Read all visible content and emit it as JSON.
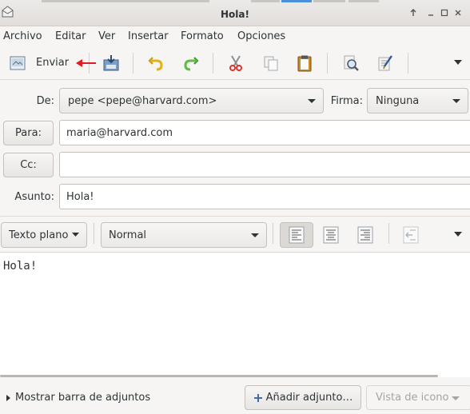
{
  "window": {
    "title": "Hola!",
    "buttons": [
      "up-icon",
      "minimize-icon",
      "restore-icon",
      "close-icon"
    ]
  },
  "menubar": {
    "items": [
      "Archivo",
      "Editar",
      "Ver",
      "Insertar",
      "Formato",
      "Opciones"
    ]
  },
  "toolbar": {
    "send_label": "Enviar",
    "icons": [
      "send-icon",
      "save-icon",
      "undo-icon",
      "redo-icon",
      "cut-icon",
      "copy-icon",
      "paste-icon",
      "find-icon",
      "spellcheck-icon",
      "overflow-icon"
    ]
  },
  "header": {
    "from_label": "De:",
    "from_value": "pepe <pepe@harvard.com>",
    "signature_label": "Firma:",
    "signature_value": "Ninguna",
    "to_button": "Para:",
    "to_value": "maria@harvard.com",
    "cc_button": "Cc:",
    "cc_value": "",
    "subject_label": "Asunto:",
    "subject_value": "Hola!"
  },
  "format": {
    "mode_label": "Texto plano",
    "style_value": "Normal",
    "align_active": "left"
  },
  "editor": {
    "body": "Hola!"
  },
  "attachments": {
    "toggle_label": "Mostrar barra de adjuntos",
    "add_label": "Añadir adjunto…",
    "view_label": "Vista de icono"
  },
  "colors": {
    "accent": "#4a90d9",
    "annotation_arrow": "#e01b24"
  }
}
